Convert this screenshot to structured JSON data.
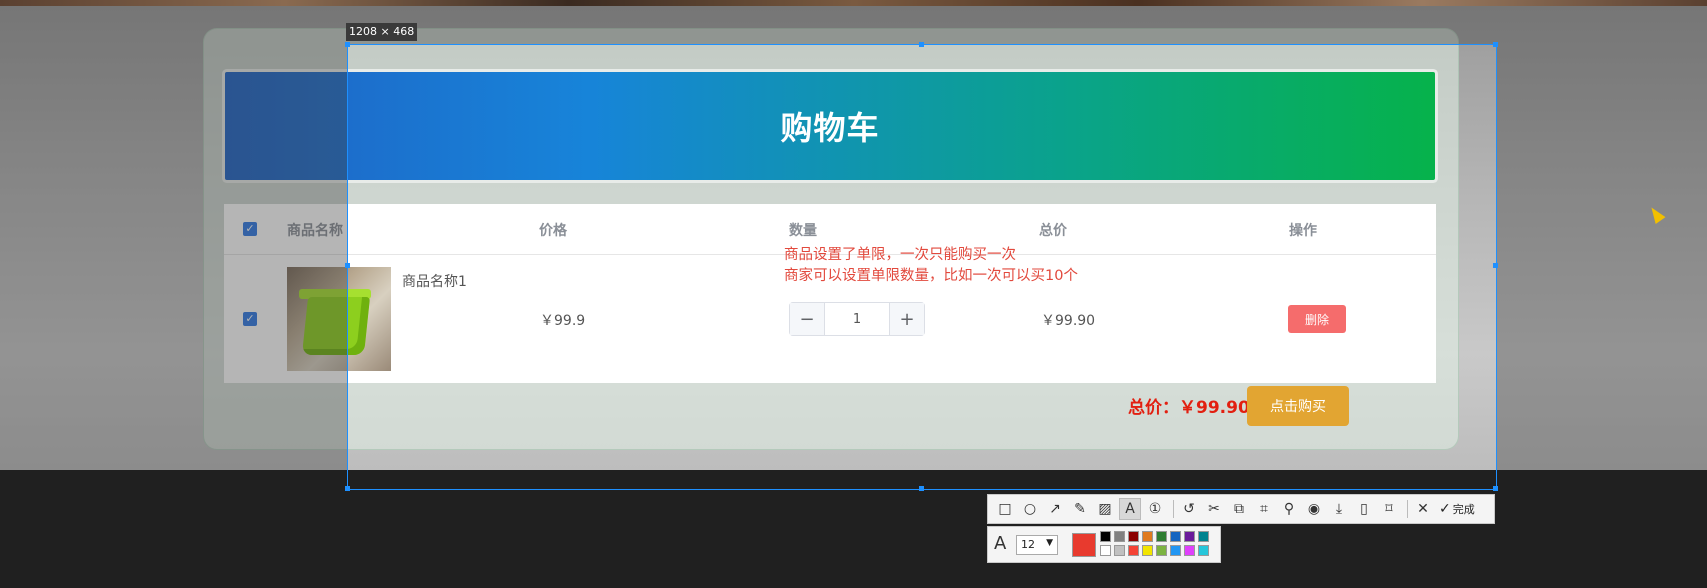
{
  "cart": {
    "title": "购物车",
    "columns": [
      "商品名称",
      "价格",
      "数量",
      "总价",
      "操作"
    ],
    "rows": [
      {
        "name": "商品名称1",
        "price": "￥99.9",
        "quantity": "1",
        "subtotal": "￥99.90",
        "action": "删除"
      }
    ],
    "qty_minus": "−",
    "qty_plus": "+",
    "total_label": "总价：￥99.90",
    "buy_label": "点击购买"
  },
  "annotation": {
    "line1": "商品设置了单限，一次只能购买一次",
    "line2": "商家可以设置单限数量，比如一次可以买10个",
    "color": "#e2493d"
  },
  "screenshot_tool": {
    "size_label": "1208 × 468",
    "done_label": "完成",
    "font_size": "12",
    "tools": [
      "rectangle-icon",
      "ellipse-icon",
      "arrow-icon",
      "pen-icon",
      "mosaic-icon",
      "text-icon",
      "number-icon",
      "undo-icon",
      "scissors-icon",
      "copy-icon",
      "ocr-icon",
      "pin-icon",
      "record-icon",
      "download-icon",
      "phone-icon",
      "bookmark-icon"
    ],
    "current_color": "#e83a2e",
    "palette": [
      "#000000",
      "#808080",
      "#8b0000",
      "#e07b1f",
      "#2e7d32",
      "#1565c0",
      "#6a1b9a",
      "#00838f",
      "#ffffff",
      "#c0c0c0",
      "#f44336",
      "#f2e500",
      "#7cb342",
      "#2196f3",
      "#e040fb",
      "#26c6da"
    ]
  }
}
